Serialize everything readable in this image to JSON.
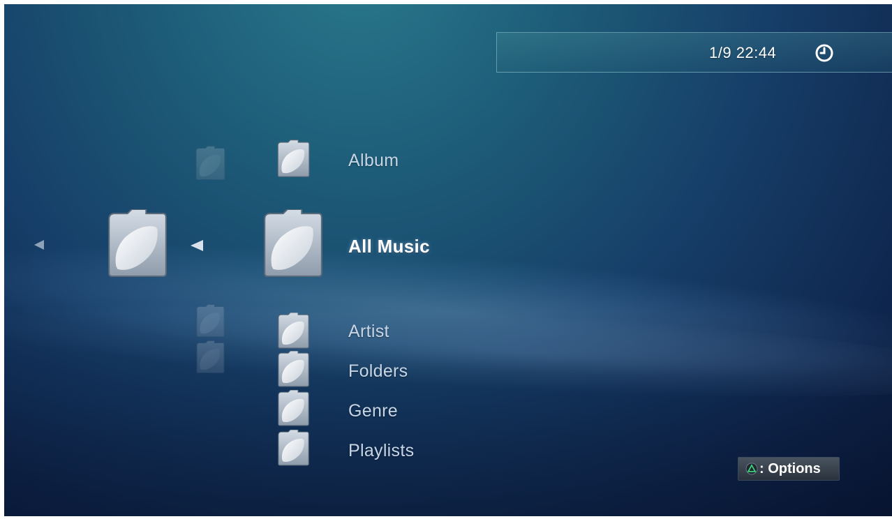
{
  "clock": {
    "text": "1/9 22:44",
    "icon": "clock-icon"
  },
  "menu": {
    "items": [
      {
        "label": "Album",
        "icon": "music-folder-icon"
      },
      {
        "label": "All Music",
        "icon": "music-folder-icon",
        "selected": true
      },
      {
        "label": "Artist",
        "icon": "music-folder-icon"
      },
      {
        "label": "Folders",
        "icon": "music-folder-icon"
      },
      {
        "label": "Genre",
        "icon": "music-folder-icon"
      },
      {
        "label": "Playlists",
        "icon": "music-folder-icon"
      }
    ]
  },
  "footer": {
    "options_label": ": Options",
    "options_icon": "triangle-button-icon"
  },
  "colors": {
    "triangle": "#3fd27a",
    "label": "#c7d6e6",
    "selected_label": "#ffffff"
  }
}
